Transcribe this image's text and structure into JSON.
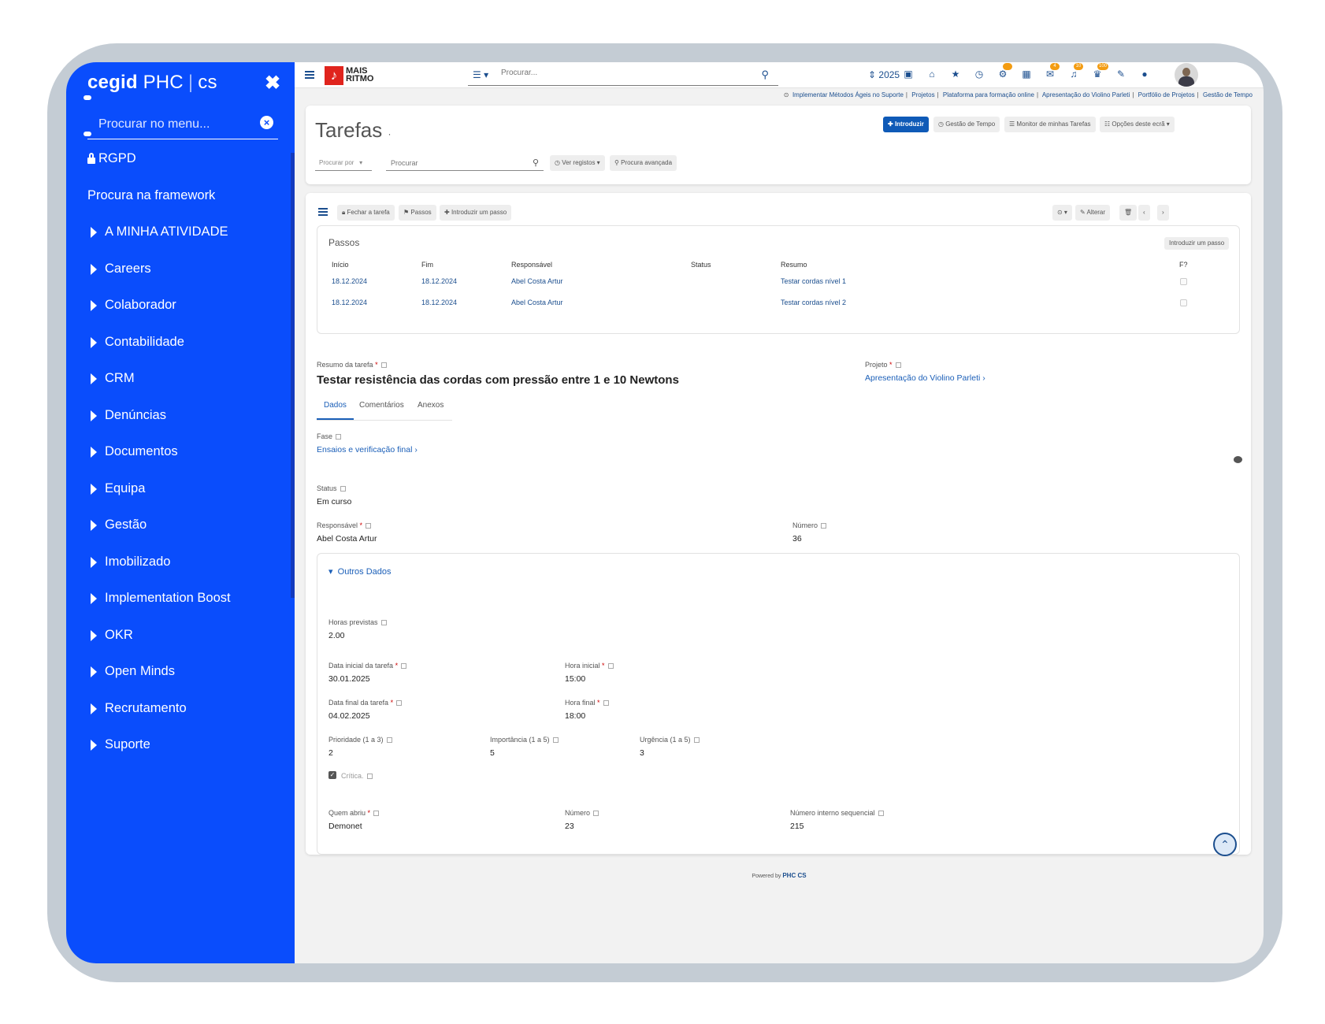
{
  "sidebar": {
    "brand": {
      "bold": "cegid",
      "rest": "PHC",
      "sep": "|",
      "cs": "cs"
    },
    "search_placeholder": "Procurar no menu...",
    "top_items": [
      {
        "label": "RGPD",
        "icon": "lock-icon"
      },
      {
        "label": "Procura na framework"
      }
    ],
    "items": [
      {
        "label": "A MINHA ATIVIDADE"
      },
      {
        "label": "Careers"
      },
      {
        "label": "Colaborador"
      },
      {
        "label": "Contabilidade"
      },
      {
        "label": "CRM"
      },
      {
        "label": "Denúncias"
      },
      {
        "label": "Documentos"
      },
      {
        "label": "Equipa"
      },
      {
        "label": "Gestão"
      },
      {
        "label": "Imobilizado"
      },
      {
        "label": "Implementation Boost"
      },
      {
        "label": "OKR"
      },
      {
        "label": "Open Minds"
      },
      {
        "label": "Recrutamento"
      },
      {
        "label": "Suporte"
      }
    ]
  },
  "topbar": {
    "logo": {
      "line1": "MAIS",
      "line2": "RITMO"
    },
    "search_placeholder": "Procurar...",
    "year": "2025",
    "badges": [
      "",
      "4",
      "10",
      "",
      "100"
    ]
  },
  "breadcrumbs": [
    "Implementar Métodos Ágeis no Suporte",
    "Projetos",
    "Plataforma para formação online",
    "Apresentação do Violino Parleti",
    "Portfólio de Projetos",
    "Gestão de Tempo"
  ],
  "header": {
    "title": "Tarefas",
    "buttons": {
      "introduzir": "Introduzir",
      "gestao_tempo": "Gestão de Tempo",
      "monitor": "Monitor de minhas Tarefas",
      "opcoes": "Opções deste ecrã"
    },
    "search_by": "Procurar por",
    "search_placeholder": "Procurar",
    "ver_registos": "Ver registos",
    "procura_avancada": "Procura avançada"
  },
  "toolbar": {
    "fechar": "Fechar a tarefa",
    "passos": "Passos",
    "introduzir_passo": "Introduzir um passo",
    "alterar": "Alterar"
  },
  "passos": {
    "title": "Passos",
    "add_button": "Introduzir um passo",
    "columns": [
      "Início",
      "Fim",
      "Responsável",
      "Status",
      "Resumo",
      "F?"
    ],
    "rows": [
      {
        "inicio": "18.12.2024",
        "fim": "18.12.2024",
        "responsavel": "Abel Costa Artur",
        "status": "",
        "resumo": "Testar cordas nível 1",
        "f": false
      },
      {
        "inicio": "18.12.2024",
        "fim": "18.12.2024",
        "responsavel": "Abel Costa Artur",
        "status": "",
        "resumo": "Testar cordas nível 2",
        "f": false
      }
    ]
  },
  "task": {
    "resumo_label": "Resumo da tarefa",
    "resumo": "Testar resistência das cordas com pressão entre 1 e 10 Newtons",
    "projeto_label": "Projeto",
    "projeto": "Apresentação do Violino Parleti",
    "tabs": [
      "Dados",
      "Comentários",
      "Anexos"
    ],
    "fase_label": "Fase",
    "fase": "Ensaios e verificação final",
    "status_label": "Status",
    "status": "Em curso",
    "responsavel_label": "Responsável",
    "responsavel": "Abel Costa Artur",
    "numero_label": "Número",
    "numero": "36"
  },
  "outros": {
    "title": "Outros Dados",
    "horas_label": "Horas previstas",
    "horas": "2.00",
    "data_ini_label": "Data inicial da tarefa",
    "data_ini": "30.01.2025",
    "hora_ini_label": "Hora inicial",
    "hora_ini": "15:00",
    "data_fim_label": "Data final da tarefa",
    "data_fim": "04.02.2025",
    "hora_fim_label": "Hora final",
    "hora_fim": "18:00",
    "prioridade_label": "Prioridade (1 a 3)",
    "prioridade": "2",
    "importancia_label": "Importância (1 a 5)",
    "importancia": "5",
    "urgencia_label": "Urgência (1 a 5)",
    "urgencia": "3",
    "critica_label": "Crítica.",
    "critica": true,
    "quem_abriu_label": "Quem abriu",
    "quem_abriu": "Demonet",
    "numero_label": "Número",
    "numero": "23",
    "num_interno_label": "Número interno sequencial",
    "num_interno": "215"
  },
  "footer": {
    "powered": "Powered by",
    "brand": "PHC CS"
  }
}
